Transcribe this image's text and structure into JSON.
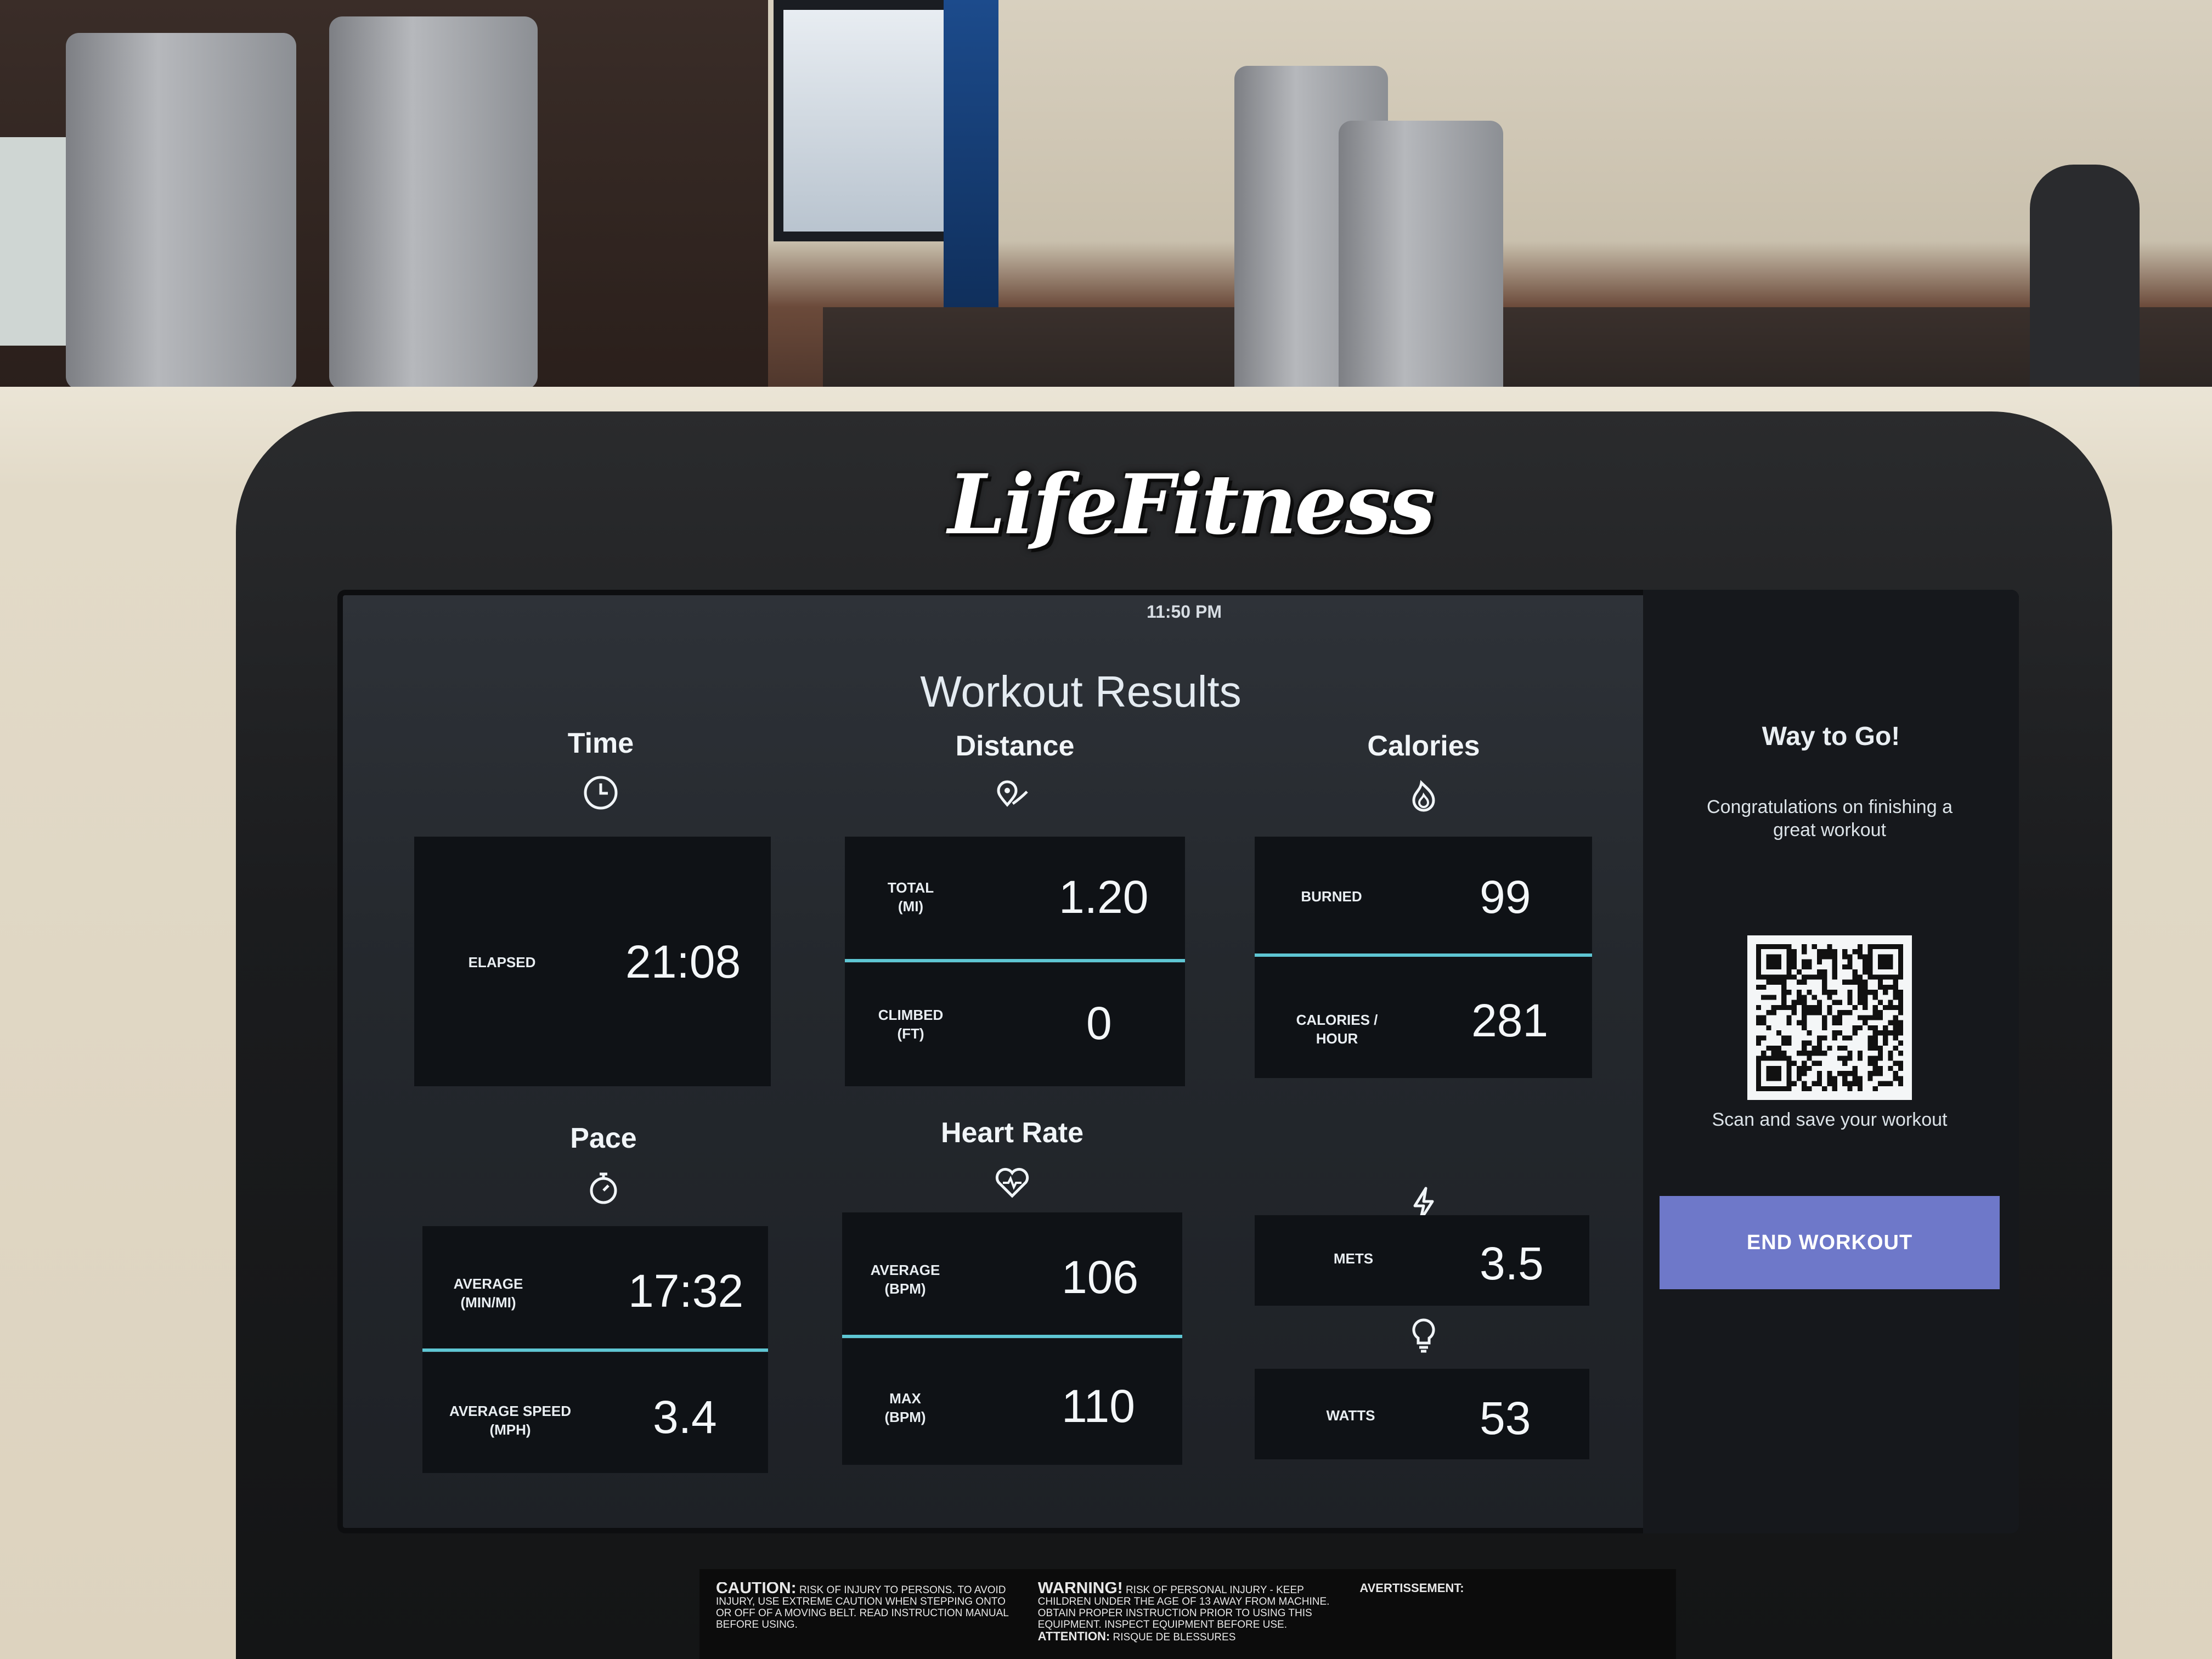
{
  "brand": {
    "logo_text": "LifeFitness"
  },
  "status_bar": {
    "time": "11:50 PM",
    "icons": [
      "headphones-icon",
      "heart-outline-icon"
    ]
  },
  "title": "Workout Results",
  "sections": {
    "time": {
      "heading": "Time",
      "icon": "clock-icon",
      "elapsed_label": "ELAPSED",
      "elapsed_value": "21:08"
    },
    "distance": {
      "heading": "Distance",
      "icon": "route-pin-icon",
      "total_label_1": "TOTAL",
      "total_label_2": "(MI)",
      "total_value": "1.20",
      "climbed_label_1": "CLIMBED",
      "climbed_label_2": "(FT)",
      "climbed_value": "0"
    },
    "calories": {
      "heading": "Calories",
      "icon": "flame-icon",
      "burned_label": "BURNED",
      "burned_value": "99",
      "per_hour_label": "CALORIES / HOUR",
      "per_hour_value": "281"
    },
    "pace": {
      "heading": "Pace",
      "icon": "stopwatch-icon",
      "avg_label_1": "AVERAGE",
      "avg_label_2": "(MIN/MI)",
      "avg_value": "17:32",
      "speed_label_1": "AVERAGE SPEED",
      "speed_label_2": "(MPH)",
      "speed_value": "3.4"
    },
    "heart_rate": {
      "heading": "Heart Rate",
      "icon": "heart-pulse-icon",
      "avg_label_1": "AVERAGE",
      "avg_label_2": "(BPM)",
      "avg_value": "106",
      "max_label_1": "MAX",
      "max_label_2": "(BPM)",
      "max_value": "110"
    },
    "energy": {
      "icon_mets": "lightning-icon",
      "icon_watts": "lightbulb-icon",
      "mets_label": "METS",
      "mets_value": "3.5",
      "watts_label": "WATTS",
      "watts_value": "53"
    }
  },
  "right_panel": {
    "heading": "Way to Go!",
    "message": "Congratulations on finishing a great workout",
    "scan_text": "Scan and save your workout",
    "end_button": "END WORKOUT"
  },
  "warnings": {
    "caution_title": "CAUTION:",
    "caution_text": "RISK OF INJURY TO PERSONS. TO AVOID INJURY, USE EXTREME CAUTION WHEN STEPPING ONTO OR OFF OF A MOVING BELT. READ INSTRUCTION MANUAL BEFORE USING.",
    "warning_title": "WARNING!",
    "warning_text": "RISK OF PERSONAL INJURY - KEEP CHILDREN UNDER THE AGE OF 13 AWAY FROM MACHINE. OBTAIN PROPER INSTRUCTION PRIOR TO USING THIS EQUIPMENT. INSPECT EQUIPMENT BEFORE USE.",
    "attention_title": "ATTENTION:",
    "attention_text": "RISQUE DE BLESSURES",
    "avert_title": "AVERTISSEMENT:"
  },
  "colors": {
    "accent": "#5ec6d3",
    "button": "#6e78c9",
    "tile": "#0f1216"
  }
}
